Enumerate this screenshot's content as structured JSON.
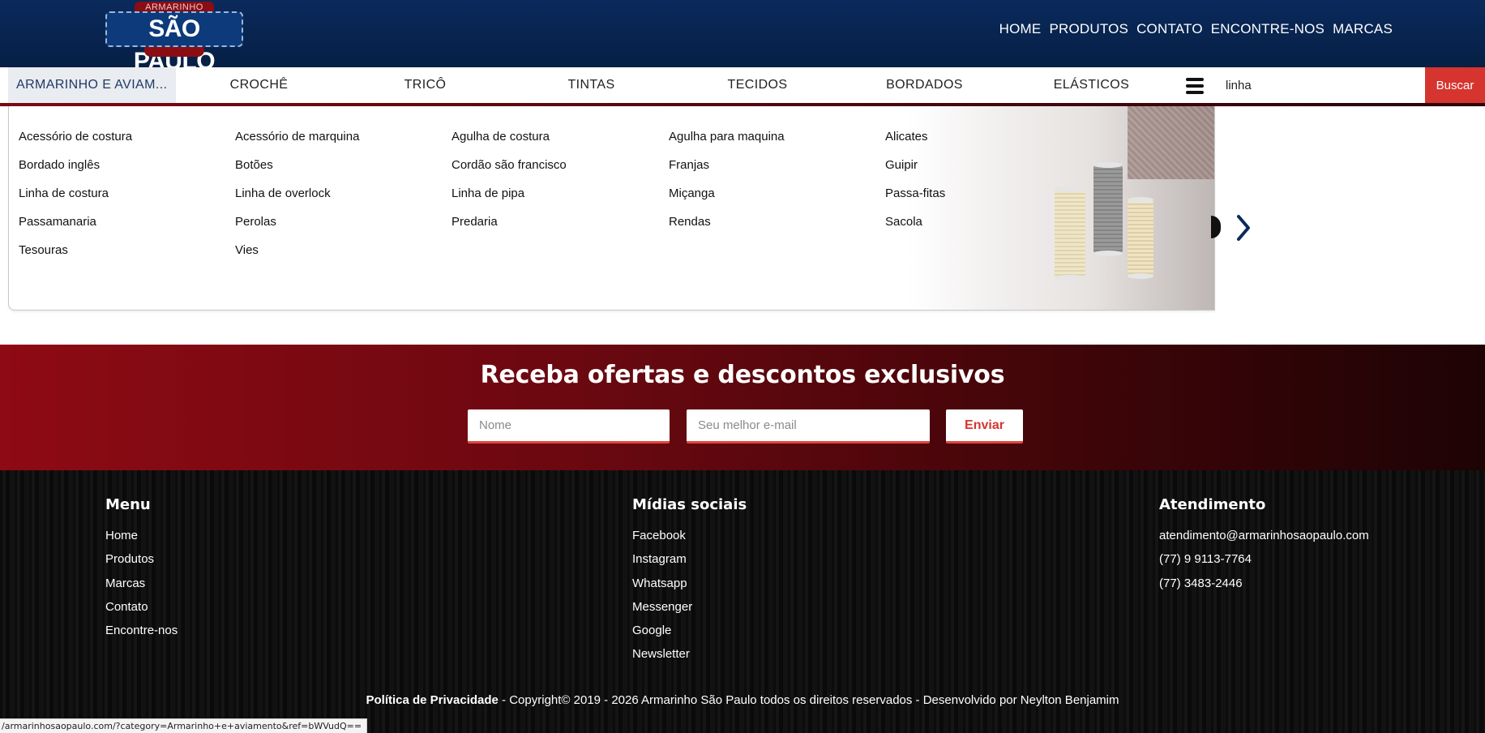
{
  "header": {
    "logo": {
      "top_text": "ARMARINHO",
      "main_text": "SÃO PAULO"
    },
    "nav": [
      "HOME",
      "PRODUTOS",
      "CONTATO",
      "ENCONTRE-NOS",
      "MARCAS"
    ]
  },
  "category_bar": {
    "categories": [
      "ARMARINHO E AVIAM...",
      "CROCHÊ",
      "TRICÔ",
      "TINTAS",
      "TECIDOS",
      "BORDADOS",
      "ELÁSTICOS"
    ],
    "search_value": "linha",
    "search_button": "Buscar"
  },
  "dropdown": {
    "columns": [
      [
        "Acessório de costura",
        "Bordado inglês",
        "Linha de costura",
        "Passamanaria",
        "Tesouras"
      ],
      [
        "Acessório de marquina",
        "Botões",
        "Linha de overlock",
        "Perolas",
        "Vies"
      ],
      [
        "Agulha de costura",
        "Cordão são francisco",
        "Linha de pipa",
        "Predaria"
      ],
      [
        "Agulha para maquina",
        "Franjas",
        "Miçanga",
        "Rendas"
      ],
      [
        "Alicates",
        "Guipir",
        "Passa-fitas",
        "Sacola"
      ]
    ]
  },
  "newsletter": {
    "title": "Receba ofertas e descontos exclusivos",
    "name_placeholder": "Nome",
    "email_placeholder": "Seu melhor e-mail",
    "submit": "Enviar"
  },
  "footer": {
    "menu": {
      "title": "Menu",
      "links": [
        "Home",
        "Produtos",
        "Marcas",
        "Contato",
        "Encontre-nos"
      ]
    },
    "social": {
      "title": "Mídias sociais",
      "links": [
        "Facebook",
        "Instagram",
        "Whatsapp",
        "Messenger",
        "Google",
        "Newsletter"
      ]
    },
    "support": {
      "title": "Atendimento",
      "items": [
        "atendimento@armarinhosaopaulo.com",
        "(77) 9 9113-7764",
        "(77) 3483-2446"
      ]
    },
    "privacy": "Política de Privacidade",
    "copyright": " - Copyright© 2019 - 2026 Armarinho São Paulo todos os direitos reservados - Desenvolvido por Neylton Benjamim"
  },
  "status_url": "/armarinhosaopaulo.com/?category=Armarinho+e+aviamento&ref=bWVudQ==",
  "colors": {
    "header_navy": "#0a2a5c",
    "accent_red": "#d6352f",
    "newsletter_red": "#8e0a14",
    "footer_black": "#0c0c0c"
  }
}
